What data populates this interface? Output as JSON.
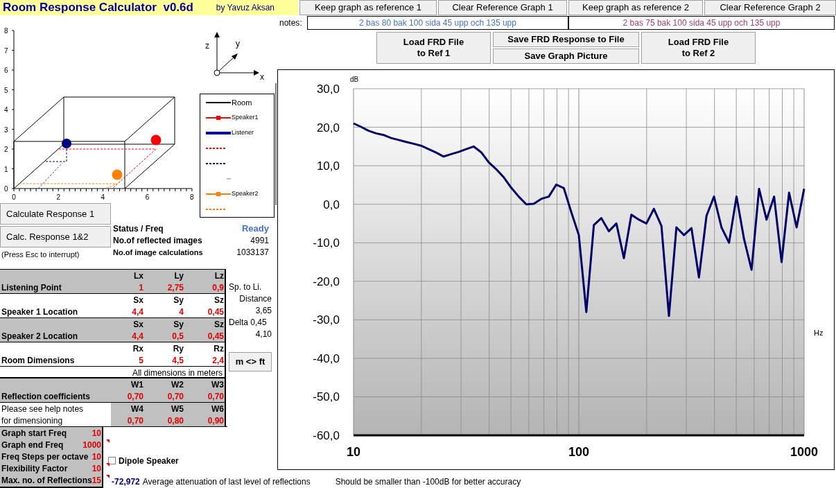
{
  "title": "Room Response Calculator  v0.6d",
  "author": "by Yavuz Aksan",
  "room_plot": {
    "yticks": [
      "8",
      "7",
      "6",
      "5",
      "4",
      "3",
      "2",
      "1",
      "0"
    ],
    "xticks": [
      "0",
      "2",
      "4",
      "6",
      "8"
    ],
    "axes_letters": [
      "z",
      "y",
      "x"
    ],
    "legend": [
      {
        "label": "Room",
        "kind": "line",
        "color": "#000000"
      },
      {
        "label": "Speaker1",
        "kind": "marker",
        "color": "#ff0000"
      },
      {
        "label": "Listener",
        "kind": "thick",
        "color": "#000099"
      },
      {
        "kind": "dashed",
        "color": "#ff0000"
      },
      {
        "kind": "dashed",
        "color": "#000080"
      },
      {
        "kind": "blank"
      },
      {
        "label": "Speaker2",
        "kind": "marker",
        "color": "#ff8000"
      },
      {
        "kind": "dashed",
        "color": "#ff8000"
      }
    ]
  },
  "calc_buttons": [
    "Calculate Response 1",
    "Calc. Response 1&2"
  ],
  "interrupt_hint": "(Press Esc to interrupt)",
  "status": [
    {
      "label": "Status / Freq",
      "value": "Ready",
      "kind": "state"
    },
    {
      "label": "No.of reflected images",
      "value": "4991",
      "kind": "count"
    },
    {
      "label": "No.of image calculations",
      "value": "1033137",
      "kind": "count"
    }
  ],
  "locations": [
    {
      "label": "Listening Point",
      "headers": [
        "Lx",
        "Ly",
        "Lz"
      ],
      "values": [
        "1",
        "2,75",
        "0,9"
      ]
    },
    {
      "label": "Speaker 1 Location",
      "headers": [
        "Sx",
        "Sy",
        "Sz"
      ],
      "values": [
        "4,4",
        "4",
        "0,45"
      ]
    },
    {
      "label": "Speaker 2 Location",
      "headers": [
        "Sx",
        "Sy",
        "Sz"
      ],
      "values": [
        "4,4",
        "0,5",
        "0,45"
      ]
    },
    {
      "label": "Room Dimensions",
      "headers": [
        "Rx",
        "Ry",
        "Rz"
      ],
      "values": [
        "5",
        "4,5",
        "2,4"
      ]
    }
  ],
  "side_notes": [
    "Sp. to Li.",
    "Distance",
    "3,65",
    "Delta 0,45",
    "4,10"
  ],
  "unit_toggle": "m <> ft",
  "units_note": "All dimensions in meters",
  "reflection": {
    "label": "Reflection coefficients",
    "headers": [
      "W1",
      "W2",
      "W3"
    ],
    "values": [
      "0,70",
      "0,70",
      "0,70"
    ]
  },
  "help_note": [
    "Please see help notes",
    "for dimensioning"
  ],
  "reflection2": {
    "headers": [
      "W4",
      "W5",
      "W6"
    ],
    "values": [
      "0,70",
      "0,80",
      "0,90"
    ]
  },
  "settings": [
    {
      "label": "Graph start Freq",
      "value": "10",
      "comment": false
    },
    {
      "label": "Graph end Freq",
      "value": "1000",
      "comment": true
    },
    {
      "label": "Freq Steps per octave",
      "value": "10",
      "comment": false
    },
    {
      "label": "Flexibility Factor",
      "value": "10",
      "comment": true
    },
    {
      "label": "Max. no. of Reflections",
      "value": "15",
      "comment": true
    }
  ],
  "dipole": {
    "label": "Dipole Speaker",
    "checked": false
  },
  "attenuation": {
    "value": "-72,972",
    "label": "Average attenuation of last level of reflections"
  },
  "accuracy_note": "Should be smaller than -100dB for better accuracy",
  "toolbar": [
    "Keep graph as reference 1",
    "Clear Reference Graph 1",
    "Keep graph as reference 2",
    "Clear Reference Graph 2"
  ],
  "notes": {
    "label": "notes:",
    "fields": [
      {
        "text": "2 bas 80 bak 100 sida 45 upp och 135 upp",
        "color": "#4472c4"
      },
      {
        "text": "2 bas 75 bak 100 sida 45 upp och 135 upp",
        "color": "#a0416e"
      }
    ]
  },
  "file_buttons": [
    "Load FRD File\nto Ref 1",
    "Save FRD Response to File",
    "Save Graph Picture",
    "Load FRD File\nto Ref 2"
  ],
  "chart": {
    "chart_data": {
      "type": "line",
      "xlabel": "Hz",
      "ylabel": "dB",
      "ylim": [
        -60,
        30
      ],
      "grid": true,
      "yticks": [
        {
          "value": 30,
          "label": "30,0"
        },
        {
          "value": 20,
          "label": "20,0"
        },
        {
          "value": 10,
          "label": "10,0"
        },
        {
          "value": 0,
          "label": "0,0"
        },
        {
          "value": -10,
          "label": "-10,0"
        },
        {
          "value": -20,
          "label": "-20,0"
        },
        {
          "value": -30,
          "label": "-30,0"
        },
        {
          "value": -40,
          "label": "-40,0"
        },
        {
          "value": -50,
          "label": "-50,0"
        },
        {
          "value": -60,
          "label": "-60,0"
        }
      ],
      "categories": [
        "10",
        null,
        null,
        null,
        null,
        null,
        null,
        null,
        null,
        null,
        null,
        null,
        null,
        null,
        null,
        null,
        null,
        null,
        null,
        null,
        null,
        null,
        null,
        null,
        null,
        null,
        null,
        null,
        null,
        null,
        "100",
        null,
        null,
        null,
        null,
        null,
        null,
        null,
        null,
        null,
        null,
        null,
        null,
        null,
        null,
        null,
        null,
        null,
        null,
        null,
        null,
        null,
        null,
        null,
        null,
        null,
        null,
        null,
        null,
        null,
        "1000"
      ],
      "series": [
        {
          "color": "#000066",
          "values": [
            21,
            20.1,
            19.1,
            18.4,
            18,
            17.2,
            16.7,
            16.2,
            15.7,
            15.2,
            14.3,
            13.4,
            12.4,
            13,
            13.6,
            14.3,
            15,
            13.5,
            10.9,
            9.1,
            7,
            4.3,
            2,
            0,
            0.1,
            1.4,
            2,
            5.1,
            4.2,
            -2.1,
            -8,
            -28,
            -5.4,
            -3.6,
            -7,
            -5,
            -14,
            -2.7,
            -4,
            -5,
            -1.2,
            -5.6,
            -29,
            -6,
            -8,
            -6.2,
            -19,
            -3,
            2,
            -6,
            -10,
            2,
            -9,
            -17,
            4,
            -4,
            2,
            -15,
            3,
            -6,
            4
          ]
        }
      ]
    }
  }
}
